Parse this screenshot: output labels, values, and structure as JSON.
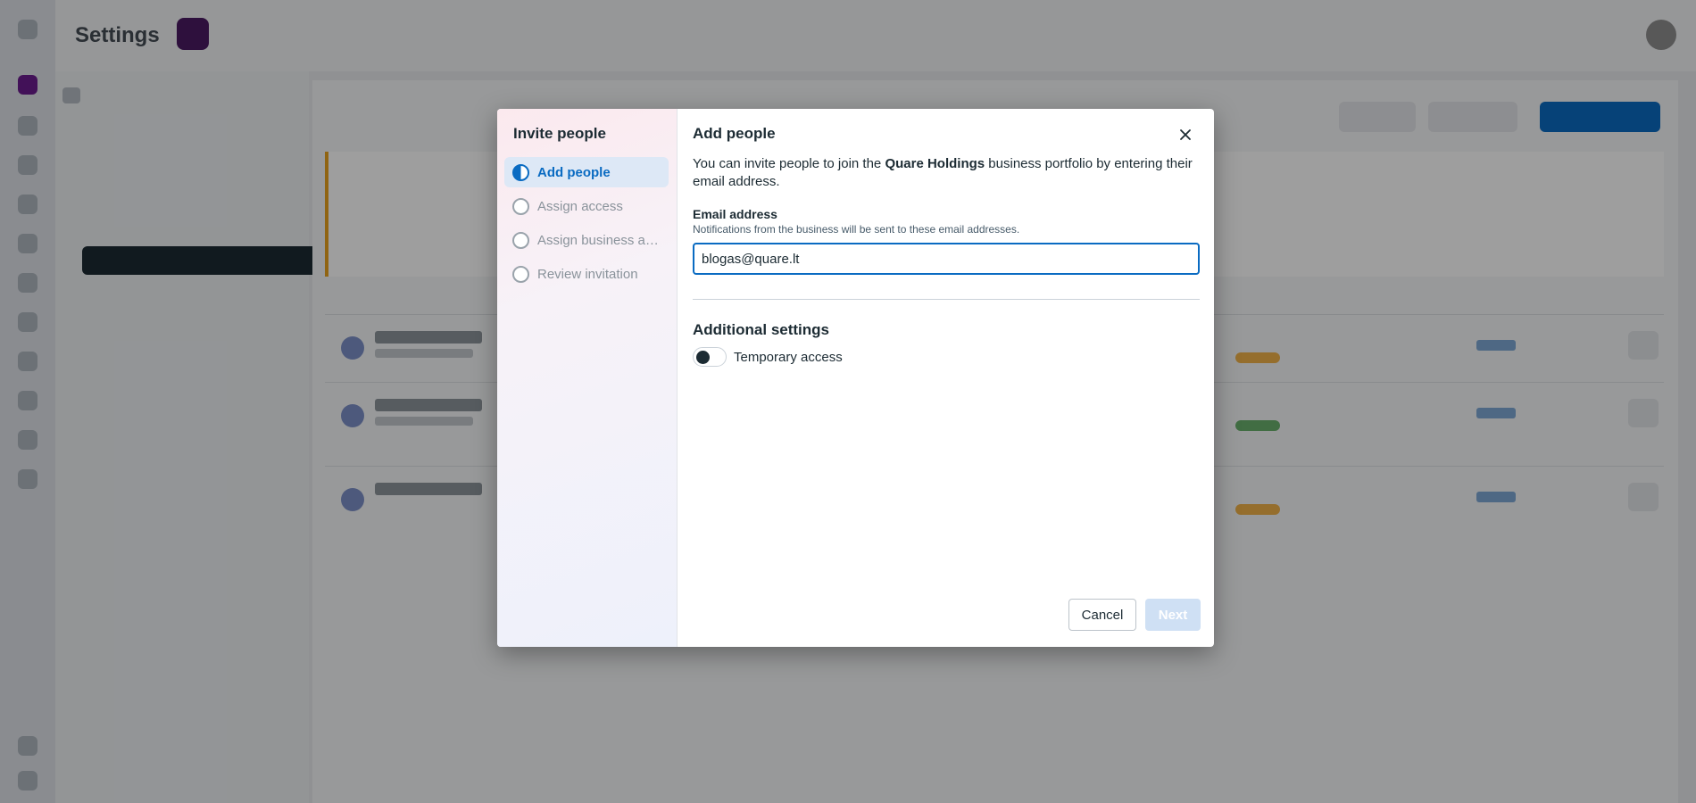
{
  "background": {
    "title": "Settings"
  },
  "modal": {
    "steps_title": "Invite people",
    "steps": [
      {
        "label": "Add people",
        "active": true
      },
      {
        "label": "Assign access",
        "active": false
      },
      {
        "label": "Assign business assets",
        "active": false
      },
      {
        "label": "Review invitation",
        "active": false
      }
    ],
    "main_title": "Add people",
    "description_prefix": "You can invite people to join the ",
    "org_name": "Quare Holdings",
    "description_suffix": " business portfolio by entering their email address.",
    "email_label": "Email address",
    "email_help": "Notifications from the business will be sent to these email addresses.",
    "email_value": "blogas@quare.lt",
    "additional_settings_title": "Additional settings",
    "temporary_access_label": "Temporary access",
    "temporary_access_on": false,
    "cancel_label": "Cancel",
    "next_label": "Next"
  },
  "colors": {
    "accent": "#0a6bc2",
    "active_step_bg": "#dde8f6",
    "next_disabled_bg": "#cfe0f4"
  }
}
